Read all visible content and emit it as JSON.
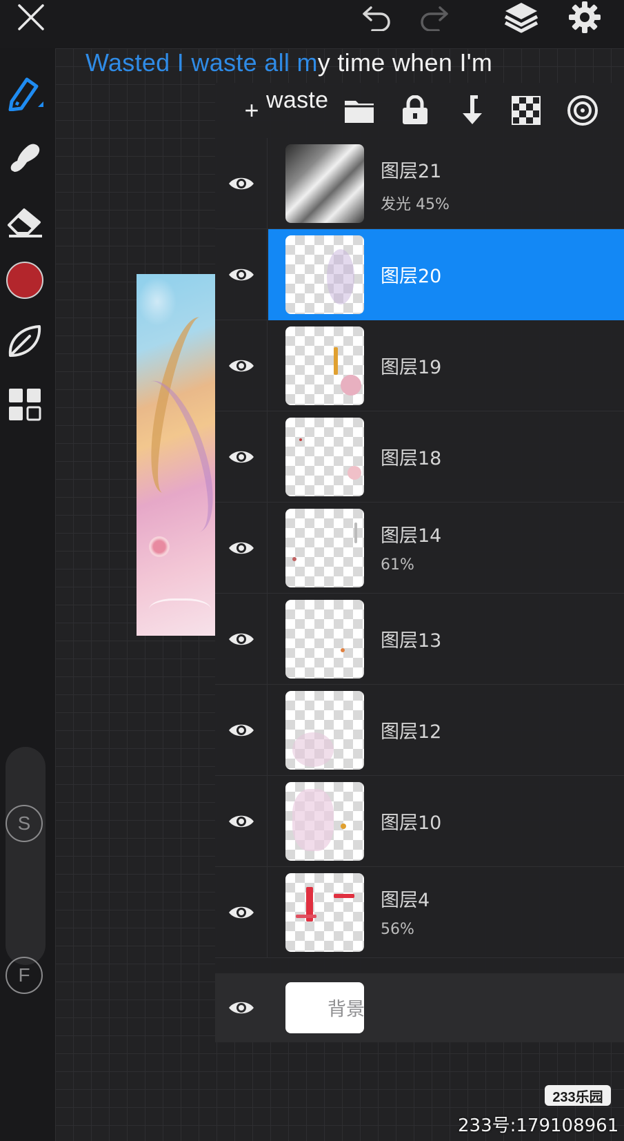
{
  "lyrics": {
    "sung": "Wasted I waste all m",
    "unsung": "y time when I'm",
    "second_line": "waste"
  },
  "layers_panel": {
    "add_label": "+",
    "layers": [
      {
        "name": "图层21",
        "blend": "发光",
        "opacity": "45%",
        "thumb": "dark",
        "selected": false
      },
      {
        "name": "图层20",
        "blend": "",
        "opacity": "",
        "thumb": "checker",
        "selected": true
      },
      {
        "name": "图层19",
        "blend": "",
        "opacity": "",
        "thumb": "checker",
        "selected": false
      },
      {
        "name": "图层18",
        "blend": "",
        "opacity": "",
        "thumb": "checker",
        "selected": false
      },
      {
        "name": "图层14",
        "blend": "",
        "opacity": "61%",
        "thumb": "checker",
        "selected": false
      },
      {
        "name": "图层13",
        "blend": "",
        "opacity": "",
        "thumb": "checker",
        "selected": false
      },
      {
        "name": "图层12",
        "blend": "",
        "opacity": "",
        "thumb": "checker",
        "selected": false
      },
      {
        "name": "图层10",
        "blend": "",
        "opacity": "",
        "thumb": "checker",
        "selected": false
      },
      {
        "name": "图层4",
        "blend": "",
        "opacity": "56%",
        "thumb": "checker",
        "selected": false
      }
    ],
    "background_label": "背景"
  },
  "toolbar": {
    "size_letter": "S",
    "flow_letter": "F",
    "current_color": "#b3262c"
  },
  "colors": {
    "accent": "#1388f5",
    "lyric_highlight": "#2f8be6"
  },
  "watermark": {
    "logo": "233乐园",
    "id_text": "233号:179108961"
  }
}
